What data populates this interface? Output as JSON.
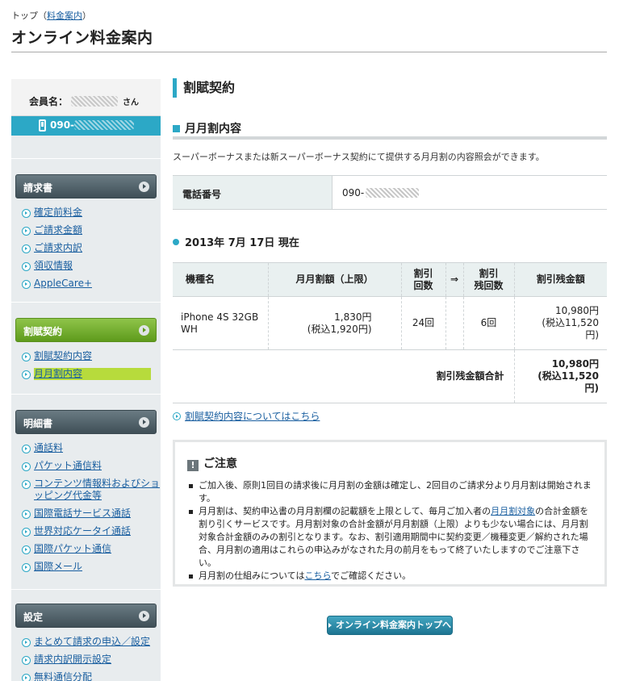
{
  "breadcrumb": {
    "top": "トップ",
    "open_paren": "（",
    "current": "料金案内",
    "close_paren": "）"
  },
  "page_title": "オンライン料金案内",
  "sidebar": {
    "member_label": "会員名：",
    "member_suffix": "さん",
    "phone_prefix": "090-",
    "groups": [
      {
        "title": "請求書",
        "items": [
          "確定前料金",
          "ご請求金額",
          "ご請求内訳",
          "領収情報",
          "AppleCare+"
        ]
      },
      {
        "title": "割賦契約",
        "items": [
          "割賦契約内容",
          "月月割内容"
        ],
        "active": true
      },
      {
        "title": "明細書",
        "items": [
          "通話料",
          "パケット通信料",
          "コンテンツ情報料およびショッピング代金等",
          "国際電話サービス通話",
          "世界対応ケータイ通話",
          "国際パケット通信",
          "国際メール"
        ]
      },
      {
        "title": "設定",
        "items": [
          "まとめて請求の申込／設定",
          "請求内訳開示設定",
          "無料通信分配"
        ]
      }
    ]
  },
  "main": {
    "heading": "割賦契約",
    "subheading": "月月割内容",
    "description": "スーパーボーナスまたは新スーパーボーナス契約にて提供する月月割の内容照会ができます。",
    "phone_label": "電話番号",
    "phone_value": "090-",
    "date_heading": "2013年 7月 17日 現在",
    "table": {
      "headers": {
        "model": "機種名",
        "monthly": "月月割額（上限）",
        "count_1": "割引",
        "count_2": "回数",
        "arrow": "⇒",
        "remain_1": "割引",
        "remain_2": "残回数",
        "balance": "割引残金額"
      },
      "row": {
        "model_1": "iPhone 4S 32GB",
        "model_2": "WH",
        "monthly_1": "1,830円",
        "monthly_2": "(税込1,920円)",
        "count": "24回",
        "remain": "6回",
        "balance_1": "10,980円",
        "balance_2": "(税込11,520",
        "balance_3": "円)"
      },
      "total_label": "割引残金額合計",
      "total_1": "10,980円",
      "total_2": "(税込11,520",
      "total_3": "円)"
    },
    "detail_link": "割賦契約内容についてはこちら",
    "notice": {
      "title": "ご注意",
      "warn_mark": "!",
      "item1": "ご加入後、原則1回目の請求後に月月割の金額は確定し、2回目のご請求分より月月割は開始されます。",
      "item2_a": "月月割は、契約申込書の月月割欄の記載額を上限として、毎月ご加入者の",
      "item2_link": "月月割対象",
      "item2_b": "の合計金額を割り引くサービスです。月月割対象の合計金額が月月割額（上限）よりも少ない場合には、月月割対象合計金額のみの割引となります。なお、割引適用期間中に契約変更／機種変更／解約された場合、月月割の適用はこれらの申込みがなされた月の前月をもって終了いたしますのでご注意下さい。",
      "item3_a": "月月割の仕組みについては",
      "item3_link": "こちら",
      "item3_b": "でご確認ください。"
    },
    "button_label": "オンライン料金案内トップへ"
  }
}
